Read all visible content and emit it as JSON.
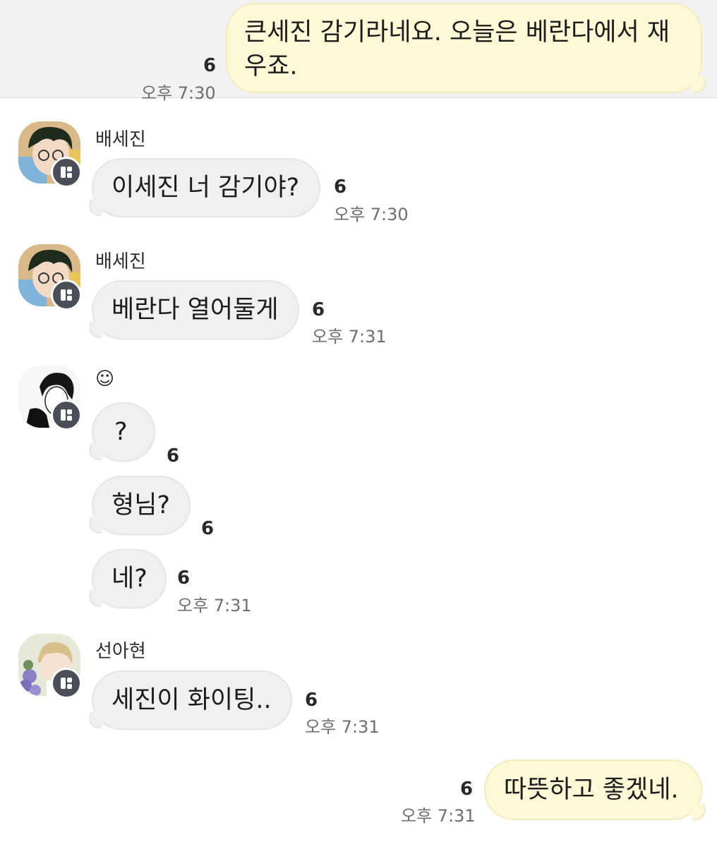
{
  "messages": [
    {
      "id": "m1",
      "text_line1": "큰세진 감기라네요. 오늘은 베란다에서 재",
      "text_line2": "우죠.",
      "unread": "6",
      "time": "오후 7:30"
    },
    {
      "id": "m2",
      "sender": "배세진",
      "text": "이세진 너 감기야?",
      "unread": "6",
      "time": "오후 7:30"
    },
    {
      "id": "m3",
      "sender": "배세진",
      "text": "베란다 열어둘게",
      "unread": "6",
      "time": "오후 7:31"
    },
    {
      "id": "m4",
      "sender": "☺",
      "text": "?",
      "unread": "6"
    },
    {
      "id": "m5",
      "text": "형님?",
      "unread": "6"
    },
    {
      "id": "m6",
      "text": "네?",
      "unread": "6",
      "time": "오후 7:31"
    },
    {
      "id": "m7",
      "sender": "선아현",
      "text": "세진이 화이팅..",
      "unread": "6",
      "time": "오후 7:31"
    },
    {
      "id": "m8",
      "text": "따뜻하고 좋겠네.",
      "unread": "6",
      "time": "오후 7:31"
    }
  ],
  "avatars": [
    {
      "name": "배세진",
      "icon": "profile-avatar"
    },
    {
      "name": "☺",
      "icon": "profile-avatar"
    },
    {
      "name": "선아현",
      "icon": "profile-avatar"
    }
  ],
  "colors": {
    "outgoing_bubble": "#fdf8d6",
    "incoming_bubble": "#f0f0f0",
    "badge": "#4a4f57"
  }
}
